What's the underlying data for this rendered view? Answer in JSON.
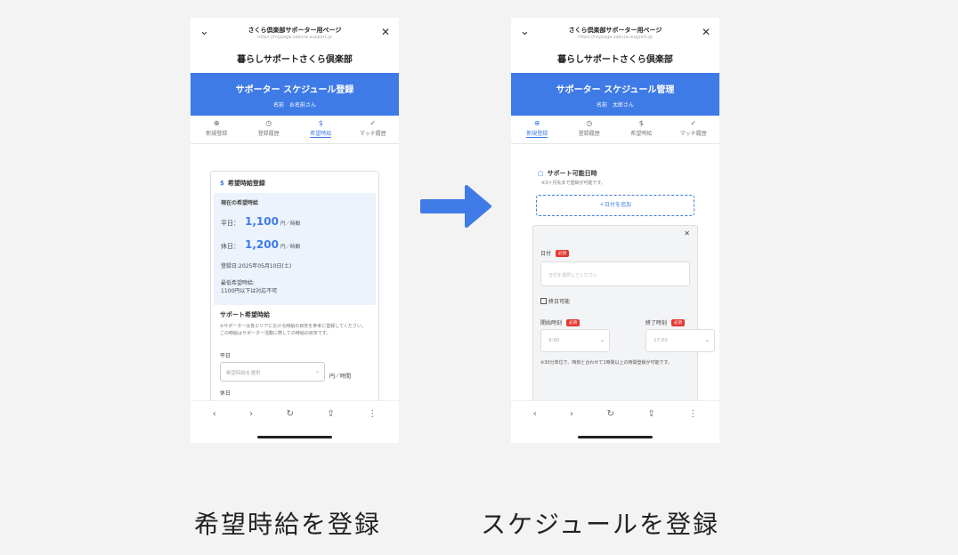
{
  "phones": [
    {
      "header_title": "さくら倶楽部サポーター用ページ",
      "header_url": "https://mypage.sakura-support.jp",
      "site_name": "暮らしサポートさくら倶楽部",
      "banner_title": "サポーター スケジュール登録",
      "banner_sub": "名前　お名前さん",
      "tabs": [
        {
          "label": "新規登録",
          "icon": "⊕"
        },
        {
          "label": "登録履歴",
          "icon": "◷"
        },
        {
          "label": "希望時給",
          "icon": "$"
        },
        {
          "label": "マッチ履歴",
          "icon": "✓"
        }
      ],
      "active_tab": 2
    },
    {
      "header_title": "さくら倶楽部サポーター用ページ",
      "header_url": "https://mypage.sakura-support.jp",
      "site_name": "暮らしサポートさくら倶楽部",
      "banner_title": "サポーター スケジュール管理",
      "banner_sub": "名前　太郎さん",
      "tabs": [
        {
          "label": "新規登録",
          "icon": "⊕"
        },
        {
          "label": "登録履歴",
          "icon": "◷"
        },
        {
          "label": "希望時給",
          "icon": "$"
        },
        {
          "label": "マッチ履歴",
          "icon": "✓"
        }
      ],
      "active_tab": 0
    }
  ],
  "wage": {
    "card_title": "希望時給登録",
    "current_label": "現在の希望時給",
    "rows": [
      {
        "label": "平日：",
        "value": "1,100",
        "unit": "円／時間"
      },
      {
        "label": "休日：",
        "value": "1,200",
        "unit": "円／時間"
      }
    ],
    "date": "登録日:2025年05月10日(土)",
    "min_label": "最低希望時給:",
    "min_value": "1100円以下は対応不可",
    "section_title": "サポート希望時給",
    "section_desc": "※サポーターは各エリアにおける時給の目安を参考に登録してください。この時給はサポーター活動に際しての時給の目安です。",
    "weekday_label": "平日",
    "select_placeholder": "希望時給を選択",
    "select_unit": "円／時間",
    "holiday_label": "休日"
  },
  "schedule": {
    "card_title": "サポート可能日時",
    "note": "※3ヶ月先まで登録が可能です。",
    "add_button": "＋日付を追加",
    "date_label": "日付",
    "required": "必須",
    "date_placeholder": "日付を選択してください",
    "checkbox_label": "終日可能",
    "start_label": "開始時刻",
    "end_label": "終了時刻",
    "start_value": "9:00",
    "end_value": "17:00",
    "form_note": "※30分単位で、時刻と合わせて1時間以上の時間登録が可能です。"
  },
  "captions": {
    "left": "希望時給を登録",
    "right": "スケジュールを登録"
  },
  "colors": {
    "accent": "#3e7be6",
    "required": "#e53935",
    "background": "#f3f3f3"
  },
  "icons": {
    "back": "‹",
    "forward": "›",
    "reload": "↻",
    "share": "⇪",
    "menu": "⋮",
    "chevron": "⌄",
    "close": "✕",
    "calendar": "▢"
  }
}
